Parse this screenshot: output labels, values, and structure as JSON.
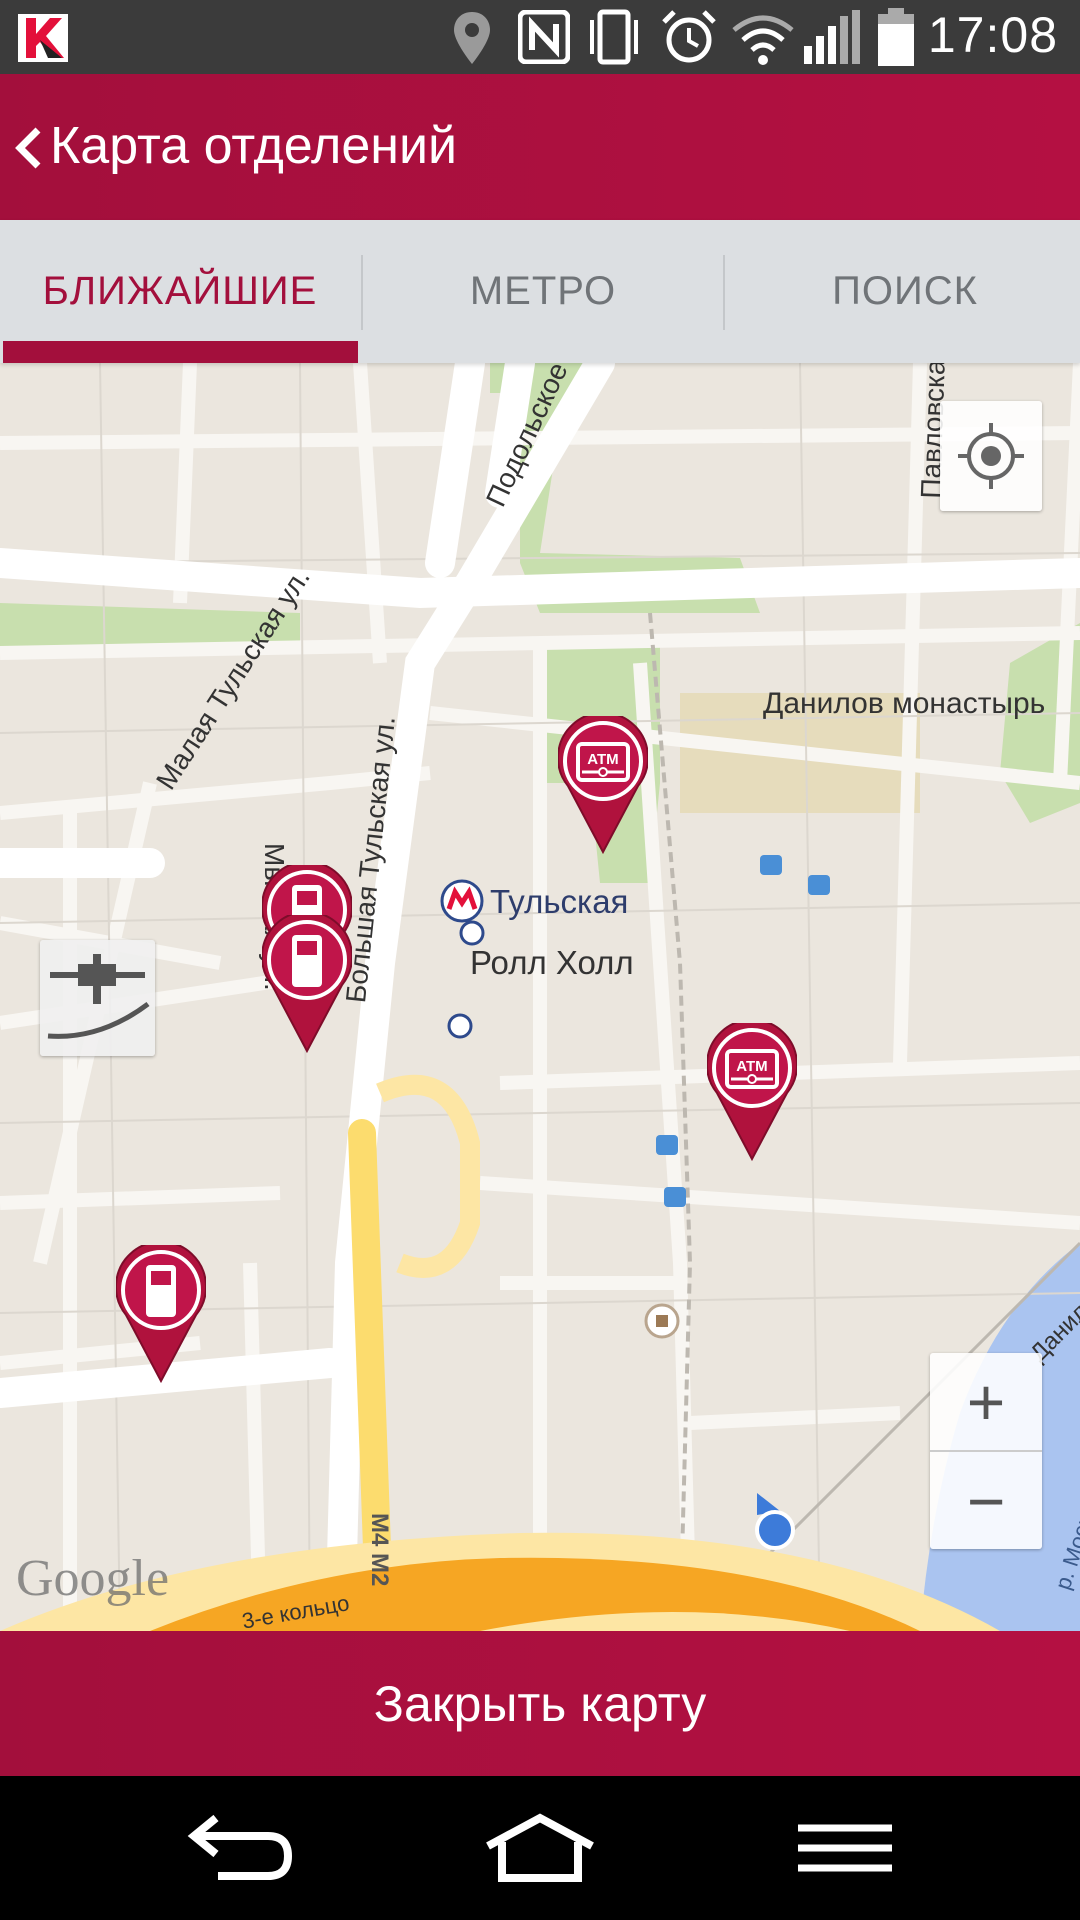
{
  "status_bar": {
    "time": "17:08",
    "icons": [
      "kaspersky-icon",
      "location-icon",
      "nfc-icon",
      "vibrate-icon",
      "alarm-icon",
      "wifi-icon",
      "signal-icon",
      "battery-icon"
    ]
  },
  "app_bar": {
    "title": "Карта отделений",
    "back_icon": "chevron-left-icon"
  },
  "tabs": [
    {
      "label": "БЛИЖАЙШИЕ",
      "active": true
    },
    {
      "label": "МЕТРО",
      "active": false
    },
    {
      "label": "ПОИСК",
      "active": false
    }
  ],
  "map": {
    "street_labels": {
      "mytnaya": "Мытная ул.",
      "podolskoe": "Подольское ш.",
      "pavlovskaya": "Павловская ул.",
      "malaya_tulskaya": "Малая Тульская ул.",
      "bolshaya_tulskaya": "Большая Тульская ул.",
      "ring": "3-е кольцо",
      "highway": "M4 M2",
      "river_road": "Данил",
      "river": "р. Москва"
    },
    "places": {
      "monastery": "Данилов монастырь",
      "metro_station": "Тульская",
      "mall": "Ролл Холл",
      "metro_symbol": "М"
    },
    "pins": [
      {
        "type": "ATM",
        "label": "ATM"
      },
      {
        "type": "terminal",
        "label": ""
      },
      {
        "type": "terminal",
        "label": ""
      },
      {
        "type": "ATM",
        "label": "ATM"
      },
      {
        "type": "terminal",
        "label": ""
      }
    ],
    "attribution": "Google",
    "controls": {
      "zoom_in": "+",
      "zoom_out": "−",
      "my_location_icon": "crosshair-icon"
    }
  },
  "close_button": {
    "label": "Закрыть карту"
  },
  "nav_bar": {
    "icons": [
      "back-arrow-icon",
      "home-icon",
      "menu-icon"
    ]
  },
  "colors": {
    "brand": "#a30f3c",
    "tab_bg": "#dcdfe2",
    "map_bg": "#ebe6de",
    "ring_road": "#f6a623"
  }
}
